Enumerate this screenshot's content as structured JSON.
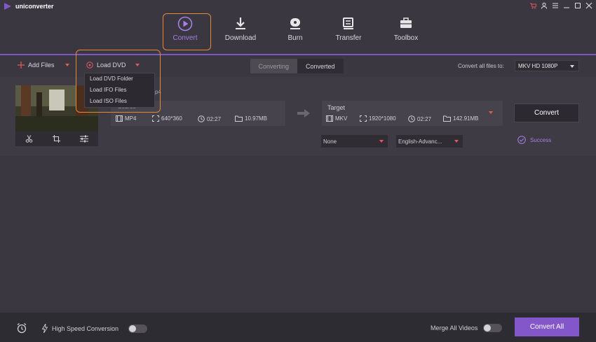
{
  "app": {
    "title": "uniconverter"
  },
  "nav": [
    {
      "label": "Convert",
      "icon": "play-circle-icon"
    },
    {
      "label": "Download",
      "icon": "download-icon"
    },
    {
      "label": "Burn",
      "icon": "disc-icon"
    },
    {
      "label": "Transfer",
      "icon": "transfer-icon"
    },
    {
      "label": "Toolbox",
      "icon": "toolbox-icon"
    }
  ],
  "toolbar": {
    "add_files": "Add Files",
    "load_dvd": "Load DVD",
    "tabs": [
      "Converting",
      "Converted"
    ],
    "convert_all_label": "Convert all files to:",
    "convert_all_format": "MKV HD 1080P"
  },
  "dvd_menu": [
    "Load DVD Folder",
    "Load IFO Files",
    "Load ISO Files"
  ],
  "file": {
    "source_partial": "Source",
    "name_partial": "p4",
    "source": {
      "format": "MP4",
      "resolution": "640*360",
      "duration": "02:27",
      "size": "10.97MB"
    },
    "target": {
      "label": "Target",
      "format": "MKV",
      "resolution": "1920*1080",
      "duration": "02:27",
      "size": "142.91MB"
    },
    "subtitle": "None",
    "audio": "English-Advanc...",
    "convert_label": "Convert",
    "status": "Success"
  },
  "bottom": {
    "high_speed": "High Speed Conversion",
    "merge": "Merge All Videos",
    "convert_all": "Convert All"
  },
  "colors": {
    "accent": "#8356c9",
    "highlight": "#e8883a",
    "caret": "#e25b5b"
  }
}
